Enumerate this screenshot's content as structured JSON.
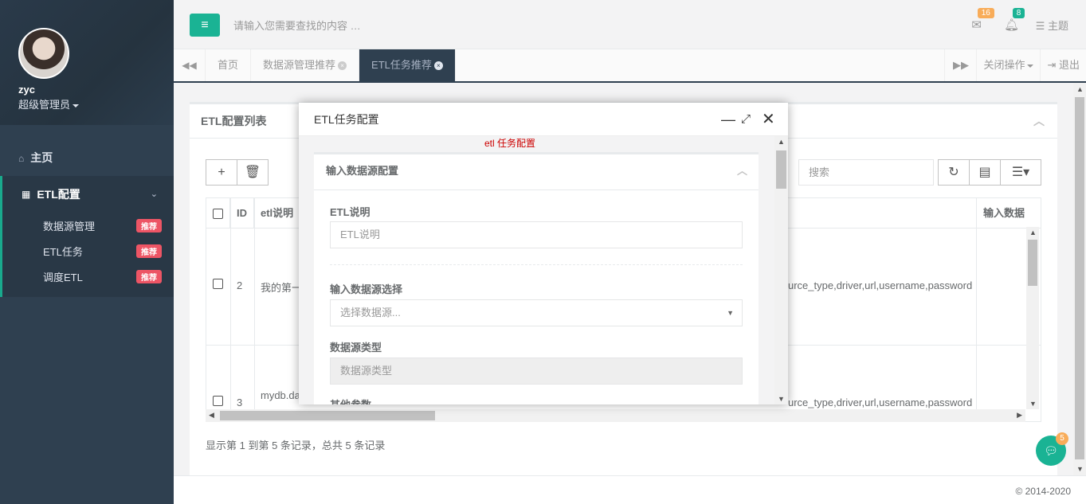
{
  "sidebar": {
    "user_name": "zyc",
    "user_role": "超级管理员",
    "home_label": "主页",
    "group_label": "ETL配置",
    "items": [
      {
        "label": "数据源管理",
        "badge": "推荐"
      },
      {
        "label": "ETL任务",
        "badge": "推荐"
      },
      {
        "label": "调度ETL",
        "badge": "推荐"
      }
    ]
  },
  "topbar": {
    "search_placeholder": "请输入您需要查找的内容 …",
    "mail_count": "16",
    "bell_count": "8",
    "theme_label": "主题",
    "colors": {
      "mail_badge": "#f8ac59",
      "bell_badge": "#1ab394"
    }
  },
  "tabs": {
    "items": [
      "首页",
      "数据源管理推荐",
      "ETL任务推荐"
    ],
    "close_ops_label": "关闭操作",
    "logout_label": "退出"
  },
  "panel": {
    "title": "ETL配置列表",
    "search_placeholder": "搜索",
    "columns": [
      "ID",
      "etl说明",
      "输入数据"
    ],
    "rows": [
      {
        "id": "2",
        "desc": "我的第一",
        "fields": "urce_type,driver,url,username,password"
      },
      {
        "id": "3",
        "desc": "mydb.da",
        "fields": "urce_type,driver,url,username,password"
      }
    ],
    "summary": "显示第 1 到第 5 条记录，总共 5 条记录"
  },
  "footer": {
    "copyright": "© 2014-2020"
  },
  "chat": {
    "count": "5"
  },
  "modal": {
    "title": "ETL任务配置",
    "subtitle": "etl 任务配置",
    "section_title": "输入数据源配置",
    "fields": {
      "etl_desc_label": "ETL说明",
      "etl_desc_placeholder": "ETL说明",
      "source_select_label": "输入数据源选择",
      "source_select_placeholder": "选择数据源...",
      "source_type_label": "数据源类型",
      "source_type_placeholder": "数据源类型",
      "other_params_label": "其他参数"
    }
  }
}
